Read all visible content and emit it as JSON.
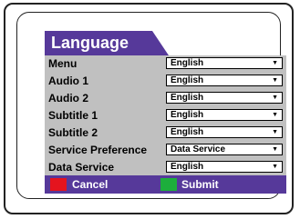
{
  "dialog": {
    "title": "Language",
    "rows": [
      {
        "label": "Menu",
        "value": "English"
      },
      {
        "label": "Audio 1",
        "value": "English"
      },
      {
        "label": "Audio 2",
        "value": "English"
      },
      {
        "label": "Subtitle 1",
        "value": "English"
      },
      {
        "label": "Subtitle 2",
        "value": "English"
      },
      {
        "label": "Service Preference",
        "value": "Data Service"
      },
      {
        "label": "Data Service",
        "value": "English"
      }
    ],
    "dropdown_arrow": "▼"
  },
  "footer": {
    "cancel_label": "Cancel",
    "submit_label": "Submit"
  },
  "colors": {
    "accent": "#56399a",
    "body_background": "#c0c0c0",
    "cancel_key": "#e5141e",
    "submit_key": "#1dae3c"
  }
}
